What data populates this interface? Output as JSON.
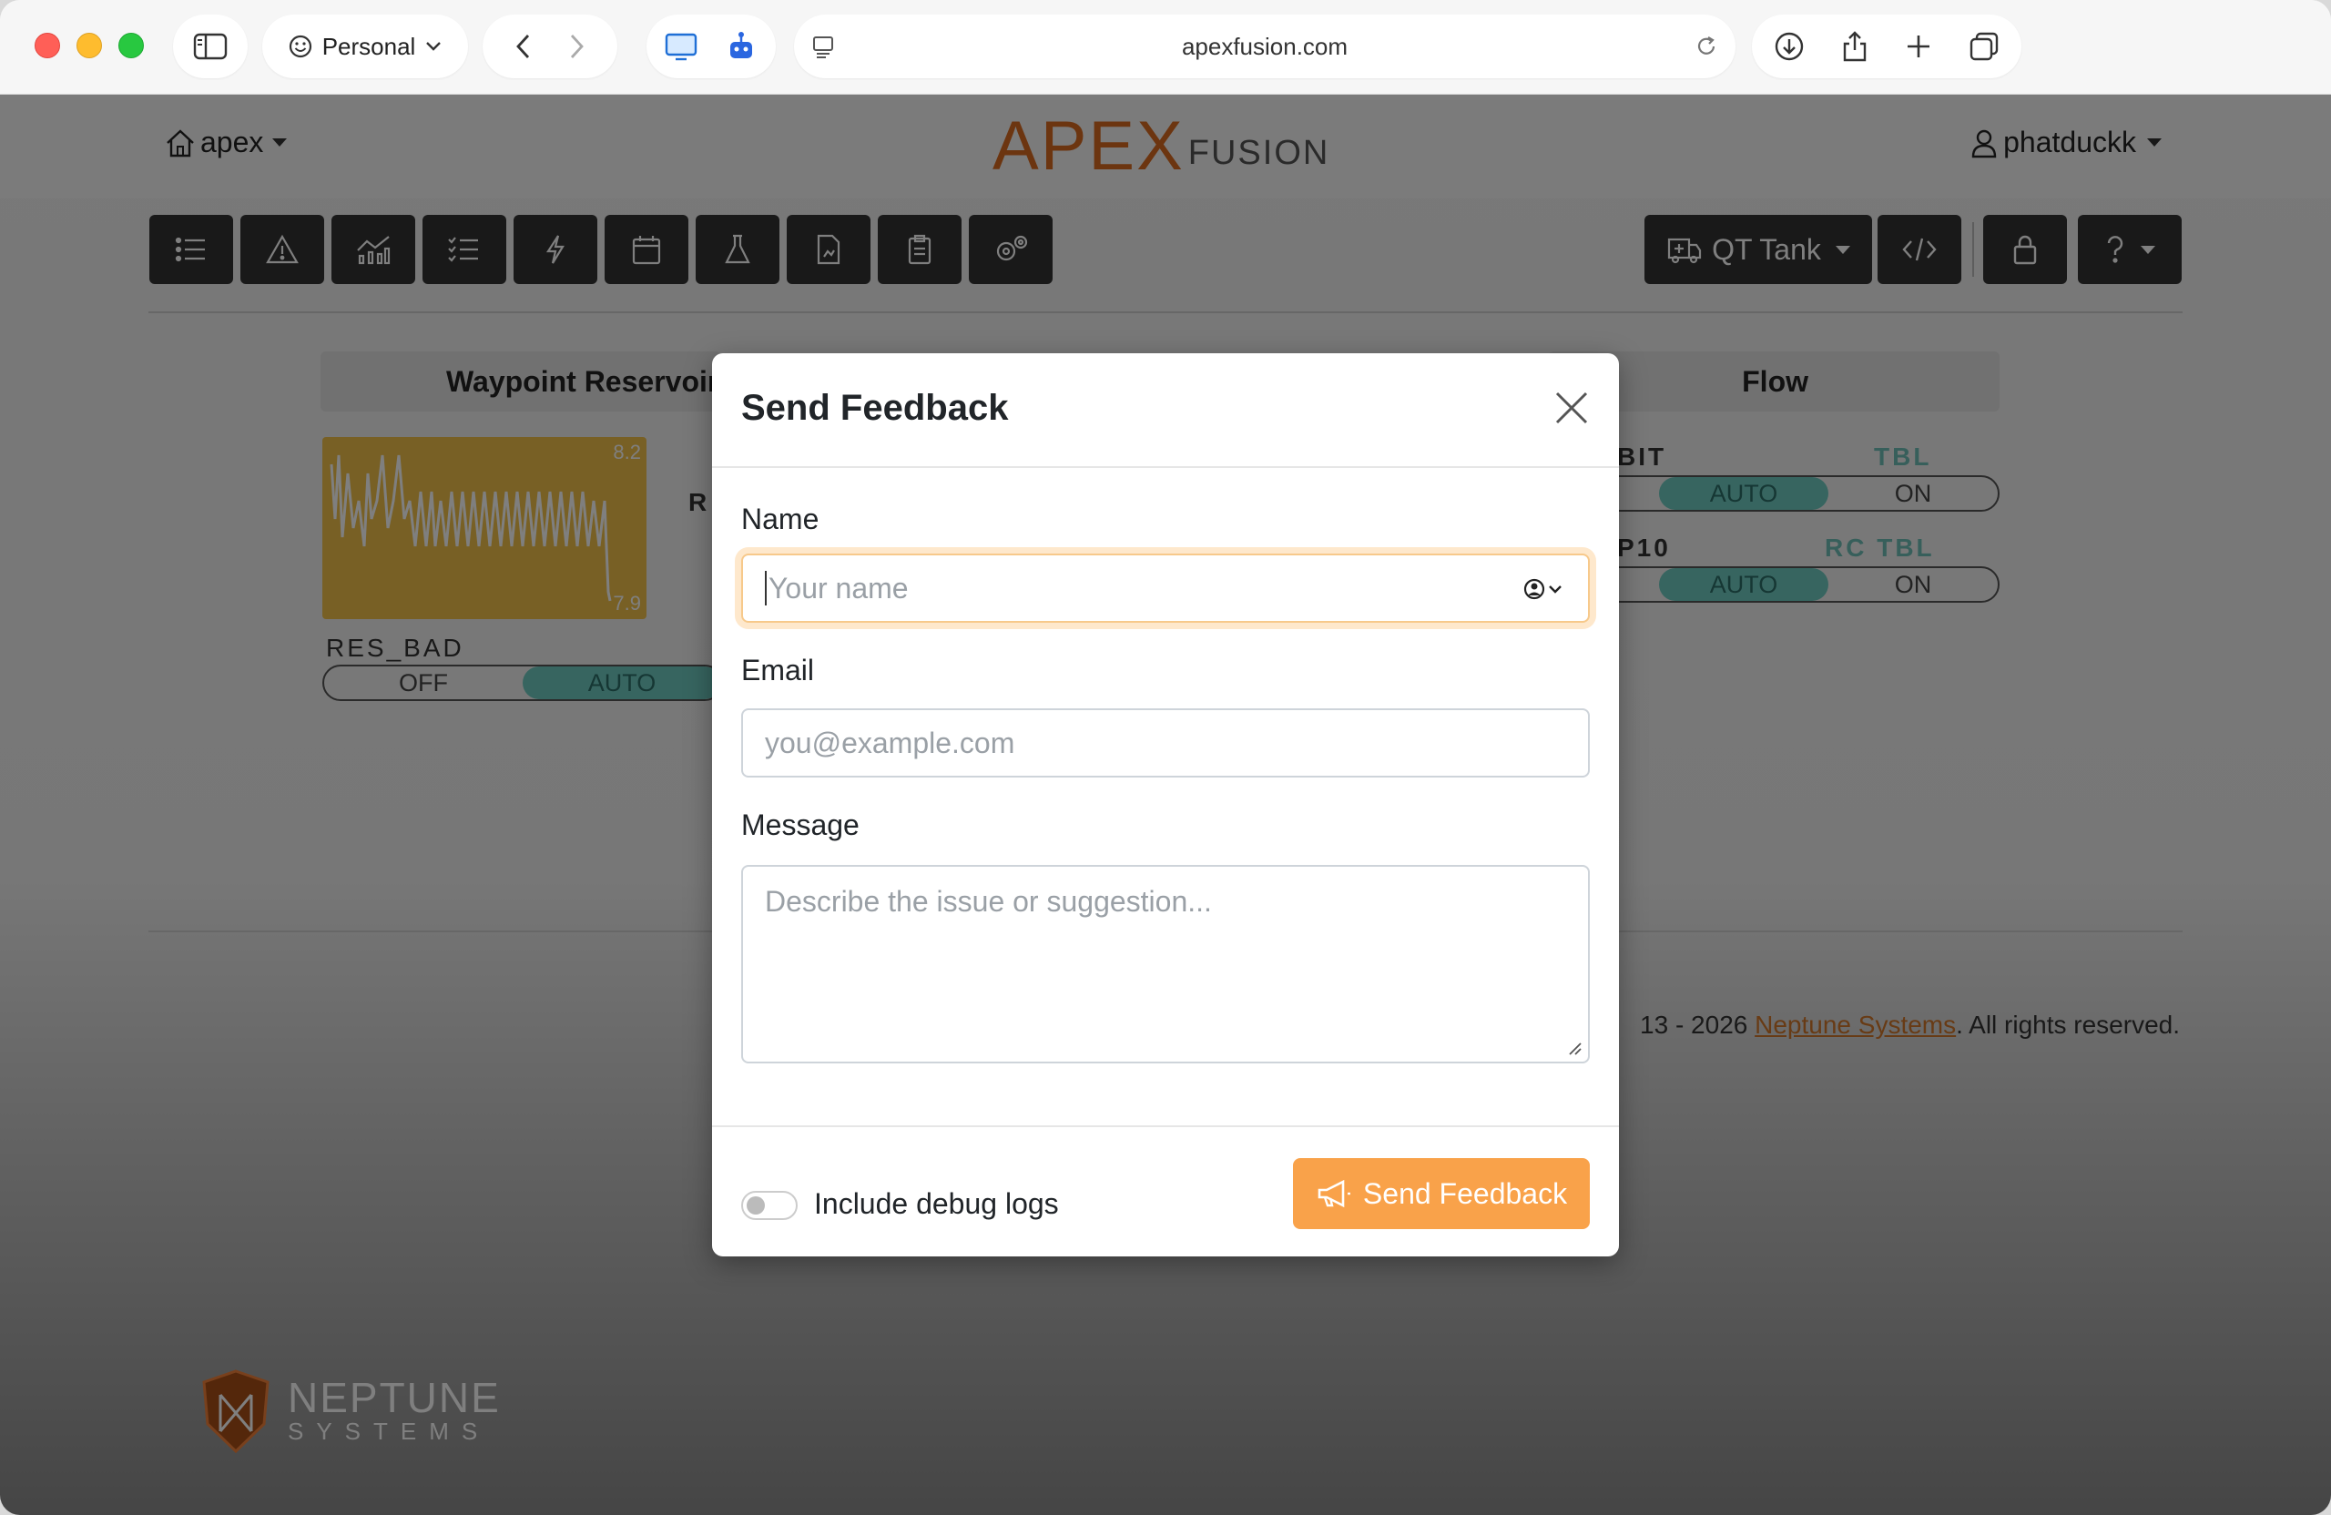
{
  "browser": {
    "profile_label": "Personal",
    "url": "apexfusion.com"
  },
  "app": {
    "home_label": "apex",
    "logo_primary": "APEX",
    "logo_secondary": "FUSION",
    "user_label": "phatduckk",
    "tank_label": "QT Tank"
  },
  "dashboard": {
    "panel_left_title": "Waypoint Reservoir",
    "panel_right_title": "Flow",
    "chart_max": "8.2",
    "chart_min": "7.9",
    "outlet_left_name": "RES_BAD",
    "seg_left": [
      "OFF",
      "AUTO"
    ],
    "outlet_right_1": "BIT",
    "outlet_right_1_cfg": "TBL",
    "outlet_right_2": "P10",
    "outlet_right_2_cfg": "RC TBL",
    "seg_right": [
      "AUTO",
      "ON"
    ],
    "partial_letter": "R"
  },
  "footer": {
    "copy_prefix": "13 - 2026 ",
    "company": "Neptune Systems",
    "copy_suffix": ". All rights reserved.",
    "brand_name": "NEPTUNE",
    "brand_sub": "SYSTEMS"
  },
  "modal": {
    "title": "Send Feedback",
    "name_label": "Name",
    "name_placeholder": "Your name",
    "email_label": "Email",
    "email_placeholder": "you@example.com",
    "message_label": "Message",
    "message_placeholder": "Describe the issue or suggestion...",
    "debug_toggle_label": "Include debug logs",
    "submit_label": "Send Feedback"
  },
  "colors": {
    "accent": "#f9a24a",
    "toolbar": "#333333",
    "brand_orange": "#d86a20",
    "chart_fill": "#f0c04a",
    "segment_active": "#6fcac0"
  }
}
